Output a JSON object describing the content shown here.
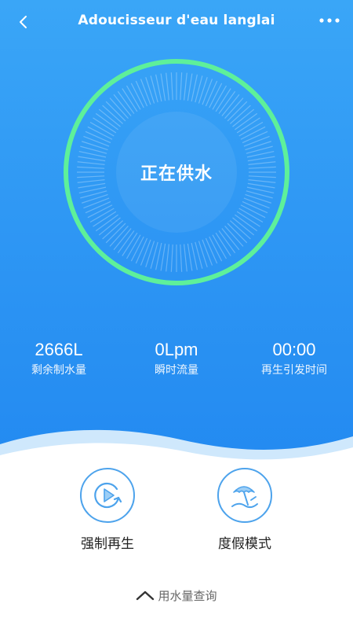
{
  "header": {
    "title": "Adoucisseur d'eau langlai",
    "back_icon": "chevron-left-icon",
    "more_icon": "more-dots-icon"
  },
  "status": {
    "text": "正在供水"
  },
  "stats": [
    {
      "value": "2666L",
      "label": "剩余制水量"
    },
    {
      "value": "0Lpm",
      "label": "瞬时流量"
    },
    {
      "value": "00:00",
      "label": "再生引发时间"
    }
  ],
  "actions": [
    {
      "label": "强制再生",
      "icon": "play-regenerate-icon"
    },
    {
      "label": "度假模式",
      "icon": "beach-umbrella-icon"
    }
  ],
  "usage_query": {
    "label": "用水量查询",
    "icon": "chevron-up-icon"
  },
  "colors": {
    "hero_top": "#3aa6f7",
    "hero_bottom": "#238af1",
    "ring_green": "#5ef09a",
    "action_outline": "#4da3ec",
    "text_dark": "#222222",
    "text_muted": "#666666"
  }
}
